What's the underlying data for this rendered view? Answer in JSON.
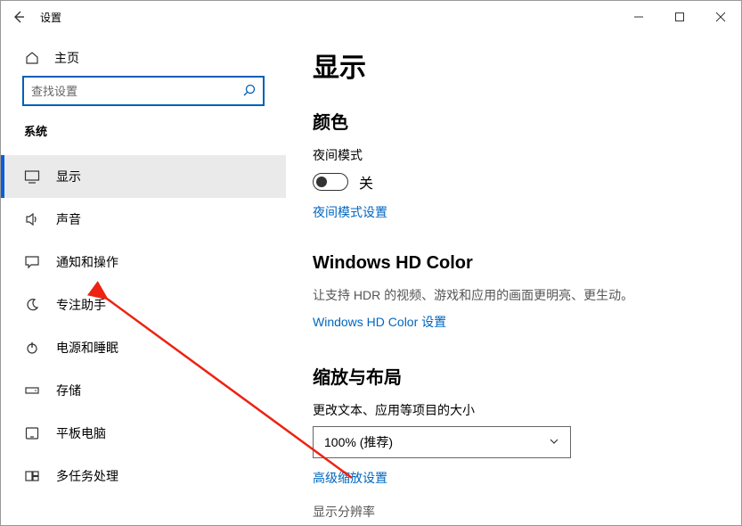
{
  "titlebar": {
    "title": "设置"
  },
  "sidebar": {
    "home": "主页",
    "search_placeholder": "查找设置",
    "group_label": "系统",
    "items": [
      {
        "label": "显示"
      },
      {
        "label": "声音"
      },
      {
        "label": "通知和操作"
      },
      {
        "label": "专注助手"
      },
      {
        "label": "电源和睡眠"
      },
      {
        "label": "存储"
      },
      {
        "label": "平板电脑"
      },
      {
        "label": "多任务处理"
      }
    ]
  },
  "content": {
    "page_title": "显示",
    "color_heading": "颜色",
    "night_mode_label": "夜间模式",
    "night_mode_state": "关",
    "night_mode_link": "夜间模式设置",
    "hd_heading": "Windows HD Color",
    "hd_desc": "让支持 HDR 的视频、游戏和应用的画面更明亮、更生动。",
    "hd_link": "Windows HD Color 设置",
    "scale_heading": "缩放与布局",
    "scale_label": "更改文本、应用等项目的大小",
    "scale_value": "100% (推荐)",
    "adv_scale_link": "高级缩放设置",
    "resolution_label_partial": "显示分辨率"
  }
}
